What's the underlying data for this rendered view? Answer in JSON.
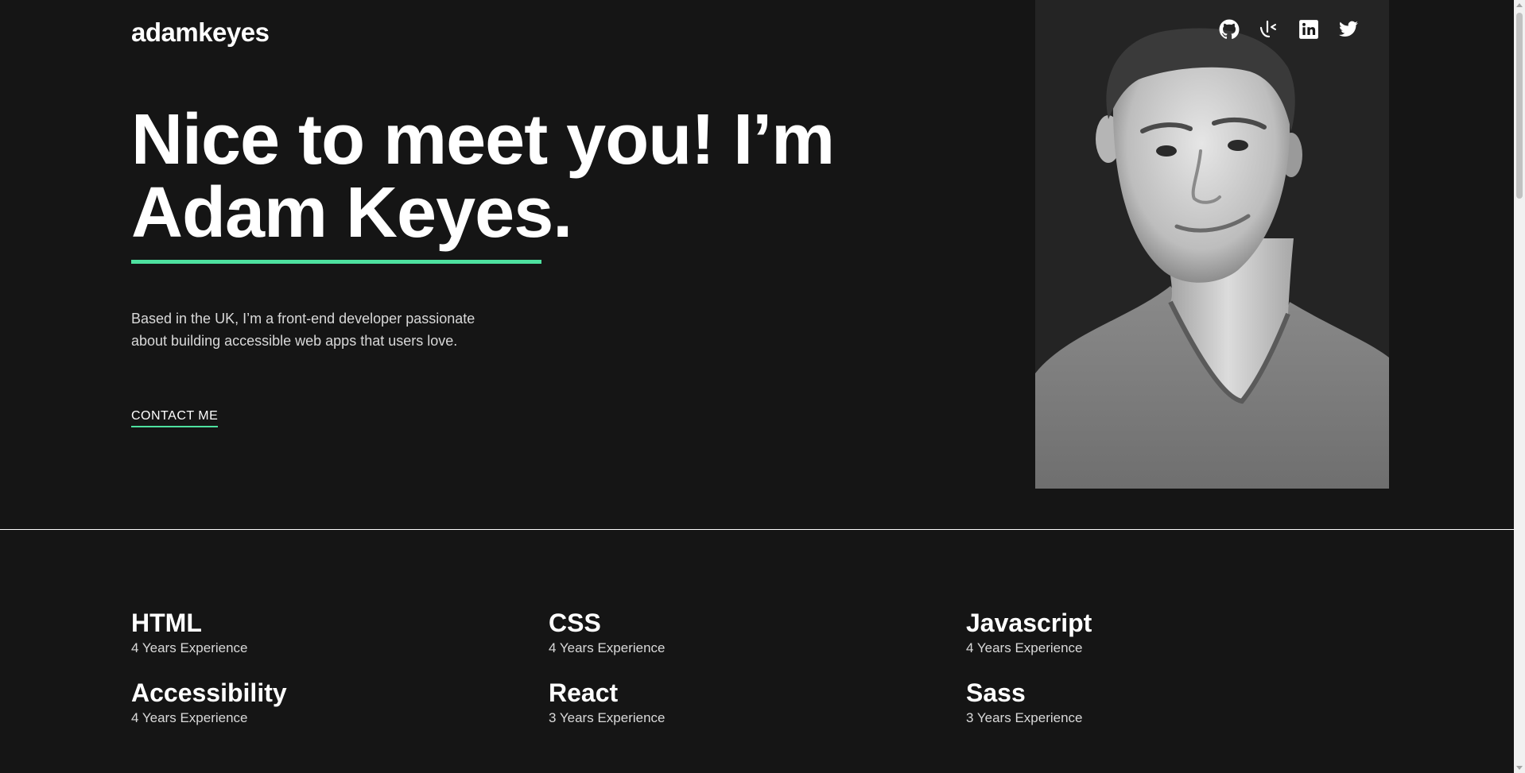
{
  "header": {
    "logo": "adamkeyes",
    "socials": [
      {
        "name": "GitHub",
        "icon": "github-icon"
      },
      {
        "name": "Frontend Mentor",
        "icon": "frontend-mentor-icon"
      },
      {
        "name": "LinkedIn",
        "icon": "linkedin-icon"
      },
      {
        "name": "Twitter",
        "icon": "twitter-icon"
      }
    ]
  },
  "hero": {
    "headline_line1": "Nice to meet you! I’m",
    "headline_line2": "Adam Keyes.",
    "intro": "Based in the UK, I’m a front-end developer passionate about building accessible web apps that users love.",
    "contact_label": "CONTACT ME"
  },
  "skills": [
    {
      "title": "HTML",
      "experience": "4 Years Experience"
    },
    {
      "title": "CSS",
      "experience": "4 Years Experience"
    },
    {
      "title": "Javascript",
      "experience": "4 Years Experience"
    },
    {
      "title": "Accessibility",
      "experience": "4 Years Experience"
    },
    {
      "title": "React",
      "experience": "3 Years Experience"
    },
    {
      "title": "Sass",
      "experience": "3 Years Experience"
    }
  ],
  "colors": {
    "background": "#151515",
    "accent": "#4ee1a0",
    "text": "#ffffff",
    "muted": "#d9d9d9",
    "photo_panel": "#242424"
  }
}
